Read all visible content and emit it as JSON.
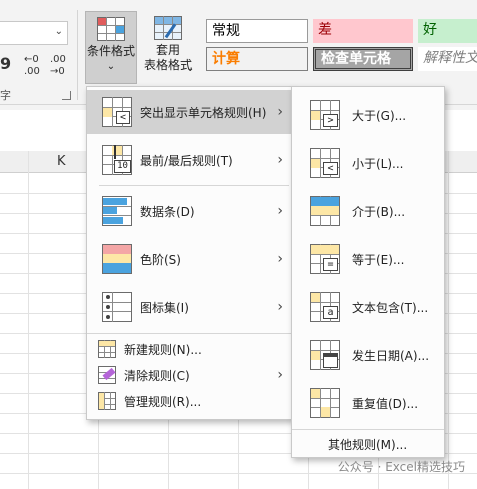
{
  "ribbon": {
    "conditional_format_label": "条件格式",
    "conditional_format_arrow": "⌄",
    "format_table_line1": "套用",
    "format_table_line2": "表格格式",
    "format_table_arrow": "⌄",
    "combo_arrow": "⌄",
    "comma_symbol": "9",
    "increase_decimal": "←0\n.00",
    "decrease_decimal": ".00\n→0",
    "group_tail": "字",
    "styles": [
      {
        "label": "常规",
        "bg": "#ffffff"
      },
      {
        "label": "差",
        "bg": "#ffc7ce"
      },
      {
        "label": "好",
        "bg": "#c6efce"
      },
      {
        "label": "计算",
        "bg": "#f2f2f2"
      },
      {
        "label": "检查单元格",
        "bg": "#a5a5a5"
      },
      {
        "label": "解释性文",
        "bg": "#ffffff"
      }
    ]
  },
  "sheet": {
    "column_k": "K"
  },
  "menu": {
    "items": [
      {
        "label": "突出显示单元格规则(H)",
        "highlighted": true,
        "has_submenu": true
      },
      {
        "label": "最前/最后规则(T)",
        "highlighted": false,
        "has_submenu": true
      },
      {
        "label": "数据条(D)",
        "highlighted": false,
        "has_submenu": true
      },
      {
        "label": "色阶(S)",
        "highlighted": false,
        "has_submenu": true
      },
      {
        "label": "图标集(I)",
        "highlighted": false,
        "has_submenu": true
      }
    ],
    "small_items": [
      {
        "label": "新建规则(N)...",
        "has_submenu": false
      },
      {
        "label": "清除规则(C)",
        "has_submenu": true
      },
      {
        "label": "管理规则(R)..."
      }
    ],
    "chevron": "›",
    "icon_number": "10"
  },
  "submenu": {
    "items": [
      {
        "label": "大于(G)...",
        "symbol": ">"
      },
      {
        "label": "小于(L)...",
        "symbol": "<"
      },
      {
        "label": "介于(B)...",
        "symbol": ""
      },
      {
        "label": "等于(E)...",
        "symbol": "="
      },
      {
        "label": "文本包含(T)...",
        "symbol": "a"
      },
      {
        "label": "发生日期(A)...",
        "symbol": ""
      },
      {
        "label": "重复值(D)...",
        "symbol": ""
      }
    ],
    "more_rules": "其他规则(M)..."
  },
  "watermark": "公众号 · Excel精选技巧",
  "colors": {
    "cell_yellow": "#fde7a6",
    "cell_blue": "#4aa3df",
    "cell_red": "#f4a6a6",
    "cell_green": "#9ed39e"
  }
}
